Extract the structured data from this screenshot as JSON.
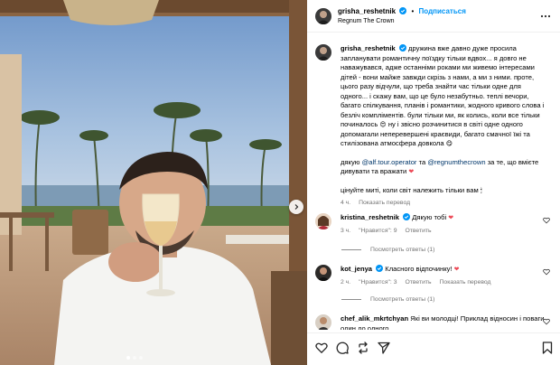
{
  "post": {
    "username": "grisha_reshetnik",
    "follow_label": "Подписаться",
    "separator": "•",
    "location": "Regnum The Crown"
  },
  "caption": {
    "username": "grisha_reshetnik",
    "text": "дружина вже давно дуже просила запланувати романтичну поїздку тільки вдвох... я довго не наважувався, адже останніми роками ми живемо інтересами дітей - вони майже завжди скрізь з нами, а ми з ними. проте, цього разу відчули, що треба знайти час тільки одне для одного... і скажу вам, що це було незабутньо. теплі вечори, багато спілкування, планів і романтики, жодного кривого слова і безліч компліментів. були тільки ми, як колись, коли все тільки починалось",
    "emoji_1": "😍",
    "text_2": " ну і звісно розчинитися в світі одне одного допомагали неперевершені краєвиди, багато смачної їжі та стилізована атмосфера довкола",
    "emoji_2": "😋",
    "thanks_prefix": "дякую ",
    "mention_1": "@alf.tour.operator",
    "thanks_and": " та ",
    "mention_2": "@regnumthecrown",
    "thanks_suffix": " за те, що вмієте дивувати та вражати ",
    "heart": "❤",
    "closing": "цінуйте миті, коли світ належить тільки вам",
    "closing_emoji": "🕯",
    "time": "4 ч.",
    "translate": "Показать перевод"
  },
  "comments": [
    {
      "username": "kristina_reshetnik",
      "text": "Дякую тобі ",
      "emoji": "❤",
      "time": "3 ч.",
      "likes": "\"Нравится\": 9",
      "reply": "Ответить",
      "view_replies": "Посмотреть ответы (1)"
    },
    {
      "username": "kot_jenya",
      "text": "Класного відпочинку! ",
      "emoji": "❤",
      "time": "2 ч.",
      "likes": "\"Нравится\": 3",
      "reply": "Ответить",
      "translate": "Показать перевод",
      "view_replies": "Посмотреть ответы (1)"
    },
    {
      "username": "chef_alik_mkrtchyan",
      "text": "Які ви молодці! Приклад відносин і поваги один до одного"
    }
  ],
  "actions": {
    "like": "heart-icon",
    "comment": "comment-icon",
    "share": "share-icon",
    "send": "send-icon",
    "save": "bookmark-icon"
  },
  "colors": {
    "link": "#0095f6",
    "mention": "#00376b",
    "muted": "#737373",
    "like_red": "#ed4956",
    "verified": "#0095f6"
  }
}
